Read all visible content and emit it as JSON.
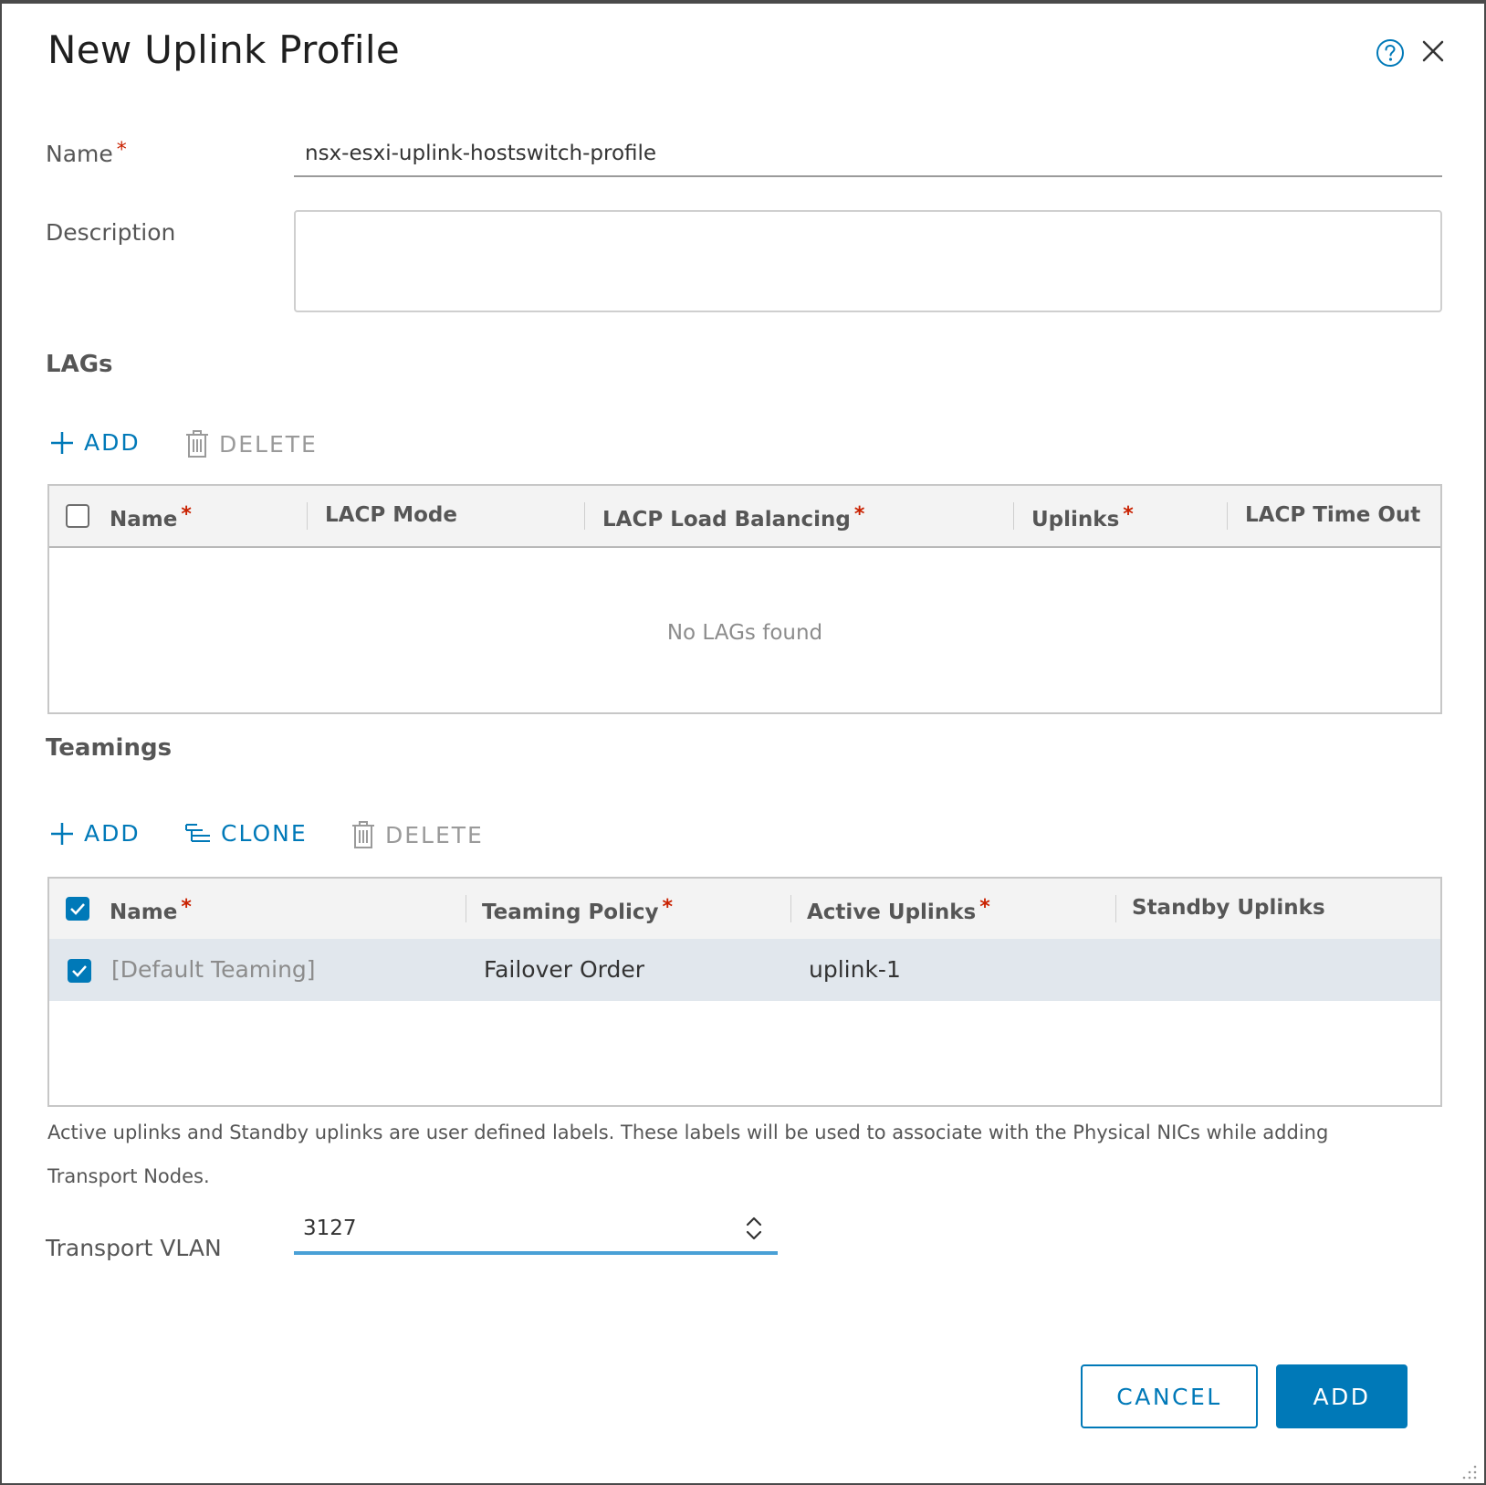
{
  "dialog": {
    "title": "New Uplink Profile",
    "help_icon": "help-circle-icon",
    "close_icon": "close-icon"
  },
  "form": {
    "name_label": "Name",
    "name_value": "nsx-esxi-uplink-hostswitch-profile",
    "description_label": "Description",
    "description_value": "",
    "transport_vlan_label": "Transport VLAN",
    "transport_vlan_value": "3127"
  },
  "lags": {
    "section_title": "LAGs",
    "add_label": "ADD",
    "delete_label": "DELETE",
    "columns": [
      "Name",
      "LACP Mode",
      "LACP Load Balancing",
      "Uplinks",
      "LACP Time Out"
    ],
    "required_columns": [
      "Name",
      "LACP Load Balancing",
      "Uplinks"
    ],
    "select_all_checked": false,
    "empty_message": "No LAGs found",
    "rows": []
  },
  "teamings": {
    "section_title": "Teamings",
    "add_label": "ADD",
    "clone_label": "CLONE",
    "delete_label": "DELETE",
    "columns": [
      "Name",
      "Teaming Policy",
      "Active Uplinks",
      "Standby Uplinks"
    ],
    "required_columns": [
      "Name",
      "Teaming Policy",
      "Active Uplinks"
    ],
    "select_all_checked": true,
    "rows": [
      {
        "checked": true,
        "name": "[Default Teaming]",
        "teaming_policy": "Failover Order",
        "active_uplinks": "uplink-1",
        "standby_uplinks": ""
      }
    ]
  },
  "note": "Active uplinks and Standby uplinks are user defined labels. These labels will be used to associate with the Physical NICs while adding Transport Nodes.",
  "footer": {
    "cancel_label": "CANCEL",
    "add_label": "ADD"
  },
  "colors": {
    "accent": "#0079b8",
    "required": "#c92100",
    "selected_row": "#e1e7ed",
    "focus_underline": "#49a0d6"
  }
}
